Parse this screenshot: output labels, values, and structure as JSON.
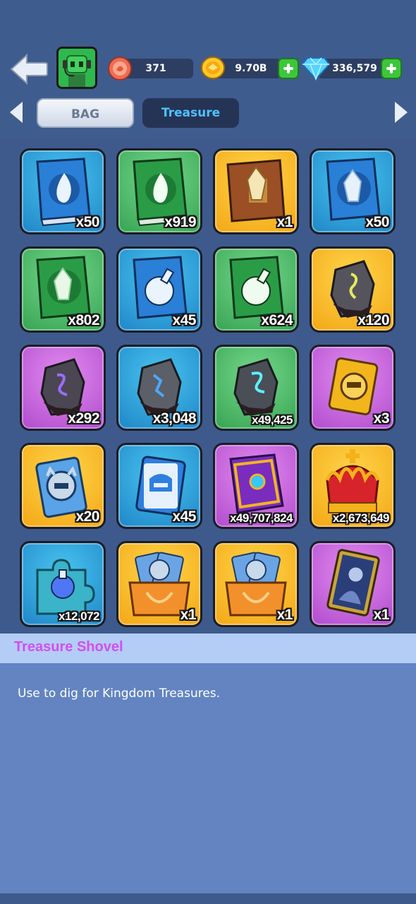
{
  "header": {
    "resources": [
      {
        "name": "energy",
        "value": "371"
      },
      {
        "name": "gold",
        "value": "9.70B"
      },
      {
        "name": "gems",
        "value": "336,579"
      }
    ]
  },
  "tabs": [
    {
      "label": "BAG",
      "active": true
    },
    {
      "label": "Treasure",
      "active": false
    }
  ],
  "items": [
    {
      "icon": "blue-flame-book-icon",
      "rarity": "blue",
      "qty": "x50"
    },
    {
      "icon": "green-flame-book-icon",
      "rarity": "green",
      "qty": "x919"
    },
    {
      "icon": "gold-crystal-book-icon",
      "rarity": "yellow",
      "qty": "x1"
    },
    {
      "icon": "blue-crystal-book-icon",
      "rarity": "blue",
      "qty": "x50"
    },
    {
      "icon": "green-crystal-book-icon",
      "rarity": "green",
      "qty": "x802"
    },
    {
      "icon": "blue-potion-book-icon",
      "rarity": "blue",
      "qty": "x45"
    },
    {
      "icon": "green-potion-book-icon",
      "rarity": "green",
      "qty": "x624"
    },
    {
      "icon": "gold-rune-stone-icon",
      "rarity": "yellow",
      "qty": "x120"
    },
    {
      "icon": "purple-rune-stone-icon",
      "rarity": "purple",
      "qty": "x292"
    },
    {
      "icon": "blue-rune-stone-icon",
      "rarity": "blue",
      "qty": "x3,048"
    },
    {
      "icon": "cyan-rune-stone-icon",
      "rarity": "green",
      "qty": "x49,425"
    },
    {
      "icon": "gold-emblem-card-icon",
      "rarity": "purple",
      "qty": "x3"
    },
    {
      "icon": "spiked-helmet-card-icon",
      "rarity": "yellow",
      "qty": "x20"
    },
    {
      "icon": "helmet-card-icon",
      "rarity": "blue",
      "qty": "x45"
    },
    {
      "icon": "jeweled-tome-icon",
      "rarity": "purple",
      "qty": "x49,707,824"
    },
    {
      "icon": "royal-crown-icon",
      "rarity": "yellow",
      "qty": "x2,673,649"
    },
    {
      "icon": "potion-puzzle-piece-icon",
      "rarity": "blue",
      "qty": "x12,072"
    },
    {
      "icon": "helmet-card-chest-icon",
      "rarity": "yellow",
      "qty": "x1"
    },
    {
      "icon": "helmet-card-chest-icon",
      "rarity": "yellow",
      "qty": "x1"
    },
    {
      "icon": "hero-portrait-card-icon",
      "rarity": "purple",
      "qty": "x1"
    }
  ],
  "detail": {
    "title": "Treasure Shovel",
    "description": "Use to dig for Kingdom Treasures."
  },
  "colors": {
    "background": "#3e5a8c",
    "detail_title": "#d54df2",
    "detail_header": "#b3cdf6",
    "detail_body": "#6384c1",
    "tab_active_text": "#4fc2ff"
  }
}
